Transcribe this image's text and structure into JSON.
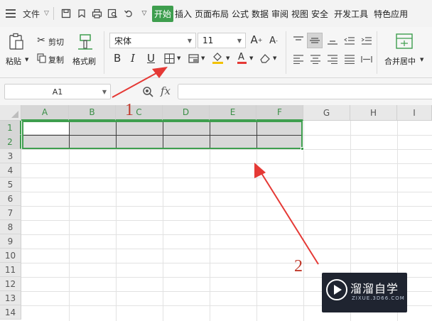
{
  "menubar": {
    "file_label": "文件",
    "tabs": [
      "开始",
      "插入",
      "页面布局",
      "公式",
      "数据",
      "审阅",
      "视图",
      "安全",
      "开发工具",
      "特色应用"
    ]
  },
  "ribbon": {
    "paste_label": "粘贴",
    "cut_label": "剪切",
    "copy_label": "复制",
    "format_painter_label": "格式刷",
    "font_name": "宋体",
    "font_size": "11",
    "bold": "B",
    "italic": "I",
    "underline": "U",
    "merge_label": "合并居中"
  },
  "formula_bar": {
    "name_box": "A1",
    "fx_label": "fx",
    "formula": ""
  },
  "sheet": {
    "columns": [
      "A",
      "B",
      "C",
      "D",
      "E",
      "F",
      "G",
      "H",
      "I"
    ],
    "rows": [
      "1",
      "2",
      "3",
      "4",
      "5",
      "6",
      "7",
      "8",
      "9",
      "10",
      "11",
      "12",
      "13",
      "14"
    ],
    "selected_range": "A1:F2",
    "accent": "#3e9e4e"
  },
  "annotations": {
    "step1": "1",
    "step2": "2",
    "arrow_color": "#e53935"
  },
  "watermark": {
    "title": "溜溜自学",
    "subtitle": "ZIXUE.3D66.COM"
  }
}
